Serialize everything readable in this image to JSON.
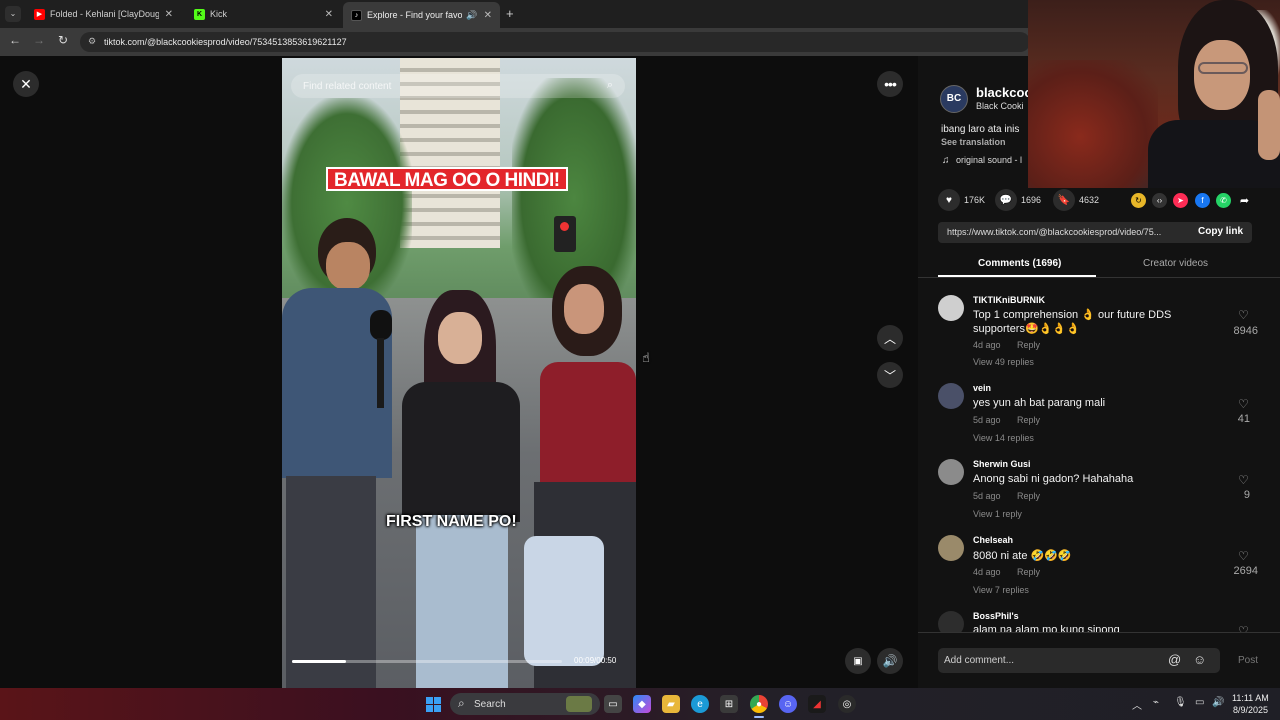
{
  "browser": {
    "tabs": [
      {
        "label": "Folded - Kehlani [ClayDough re",
        "icon": "youtube-icon",
        "color": "#ff0000"
      },
      {
        "label": "Kick",
        "icon": "kick-icon",
        "color": "#53fc18"
      },
      {
        "label": "Explore - Find your favouri",
        "icon": "tiktok-icon",
        "color": "#000000"
      }
    ],
    "url": "tiktok.com/@blackcookiesprod/video/7534513853619621127"
  },
  "video": {
    "search_placeholder": "Find related content",
    "caption_top": "BAWAL MAG OO O HINDI!",
    "caption_bottom": "FIRST NAME PO!",
    "timecode": "00:09/00:50",
    "progress": 0.2
  },
  "author": {
    "display": "blackcoo",
    "subname": "Black Cooki",
    "description": "ibang laro ata inis",
    "see_translation": "See translation",
    "sound": "original sound - l"
  },
  "stats": {
    "likes": "176K",
    "comments": "1696",
    "saves": "4632"
  },
  "share": {
    "link": "https://www.tiktok.com/@blackcookiesprod/video/75...",
    "copy_label": "Copy link"
  },
  "tabs": {
    "comments": "Comments (1696)",
    "creator": "Creator videos"
  },
  "comments": [
    {
      "user": "TIKTIKniBURNIK",
      "text": "Top 1 comprehension 👌 our future DDS",
      "text2": "supporters🤩👌👌👌",
      "time": "4d ago",
      "reply": "Reply",
      "likes": "8946",
      "replies": "View 49 replies"
    },
    {
      "user": "vein",
      "text": "yes yun ah bat parang mali",
      "time": "5d ago",
      "reply": "Reply",
      "likes": "41",
      "replies": "View 14 replies"
    },
    {
      "user": "Sherwin Gusi",
      "text": "Anong sabi ni gadon? Hahahaha",
      "time": "5d ago",
      "reply": "Reply",
      "likes": "9",
      "replies": "View 1 reply"
    },
    {
      "user": "Chelseah",
      "text": "8080 ni ate 🤣🤣🤣",
      "time": "4d ago",
      "reply": "Reply",
      "likes": "2694",
      "replies": "View 7 replies"
    },
    {
      "user": "BossPhil's",
      "text": "alam na alam mo kung sinong"
    }
  ],
  "comment_box": {
    "placeholder": "Add comment...",
    "post_label": "Post"
  },
  "taskbar": {
    "search_label": "Search",
    "time": "11:11 AM",
    "date": "8/9/2025"
  }
}
